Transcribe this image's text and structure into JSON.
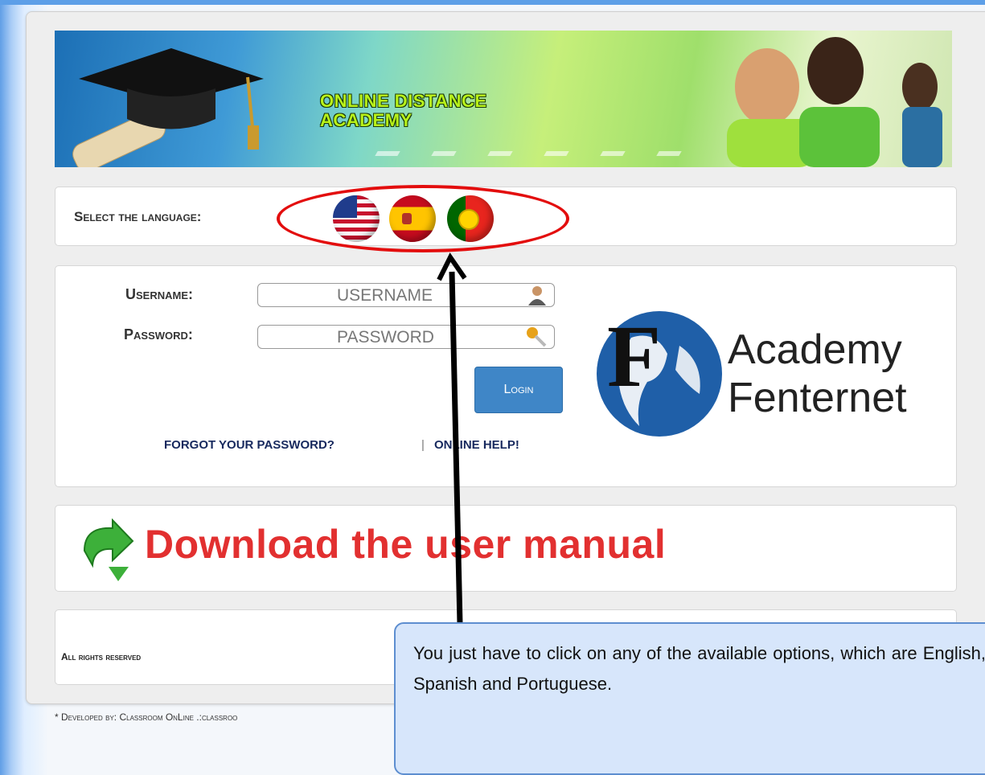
{
  "banner": {
    "title": "ONLINE DISTANCE\nACADEMY"
  },
  "language": {
    "label": "Select the language:",
    "options": [
      "English",
      "Spanish",
      "Portuguese"
    ]
  },
  "login": {
    "username_label": "Username:",
    "password_label": "Password:",
    "username_placeholder": "USERNAME",
    "password_placeholder": "PASSWORD",
    "button": "Login",
    "forgot": "FORGOT YOUR PASSWORD?",
    "separator": "|",
    "help": "ONLINE HELP!"
  },
  "logo": {
    "line1": "Academy",
    "line2": "Fenternet"
  },
  "download": {
    "text": "Download the user manual"
  },
  "footer": {
    "rights": "All rights reserved",
    "developed": "* Developed by: Classroom OnLine .:classroo"
  },
  "callout": {
    "text": "You just have to click on any of the available options, which are English, Spanish and Portuguese."
  },
  "colors": {
    "accent_button": "#3f86c7",
    "download_red": "#e23030",
    "highlight_red": "#e30d0d",
    "callout_bg": "#d7e6fb"
  }
}
